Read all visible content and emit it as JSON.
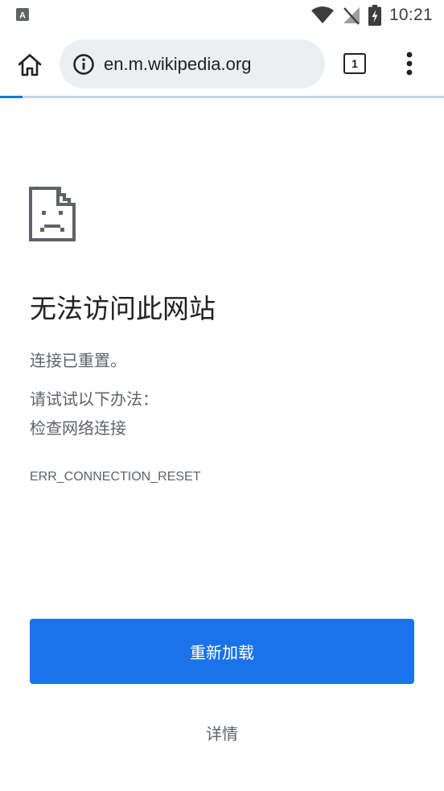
{
  "status_bar": {
    "time": "10:21",
    "icons": [
      "notification-a-icon",
      "wifi-icon",
      "no-signal-icon",
      "battery-charging-icon"
    ]
  },
  "toolbar": {
    "url": "en.m.wikipedia.org",
    "tab_count": "1",
    "icons": [
      "home-icon",
      "info-icon",
      "tab-switcher-icon",
      "more-vert-icon"
    ]
  },
  "page_load_progress": 0.05,
  "error_page": {
    "title": "无法访问此网站",
    "description": "连接已重置。",
    "suggestions_heading": "请试试以下办法：",
    "suggestions": [
      "检查网络连接"
    ],
    "error_code": "ERR_CONNECTION_RESET",
    "reload_label": "重新加载",
    "details_label": "详情"
  },
  "colors": {
    "accent": "#1a73e8",
    "text_primary": "#202124",
    "text_secondary": "#5f6368",
    "omnibox_bg": "#eceff1"
  }
}
